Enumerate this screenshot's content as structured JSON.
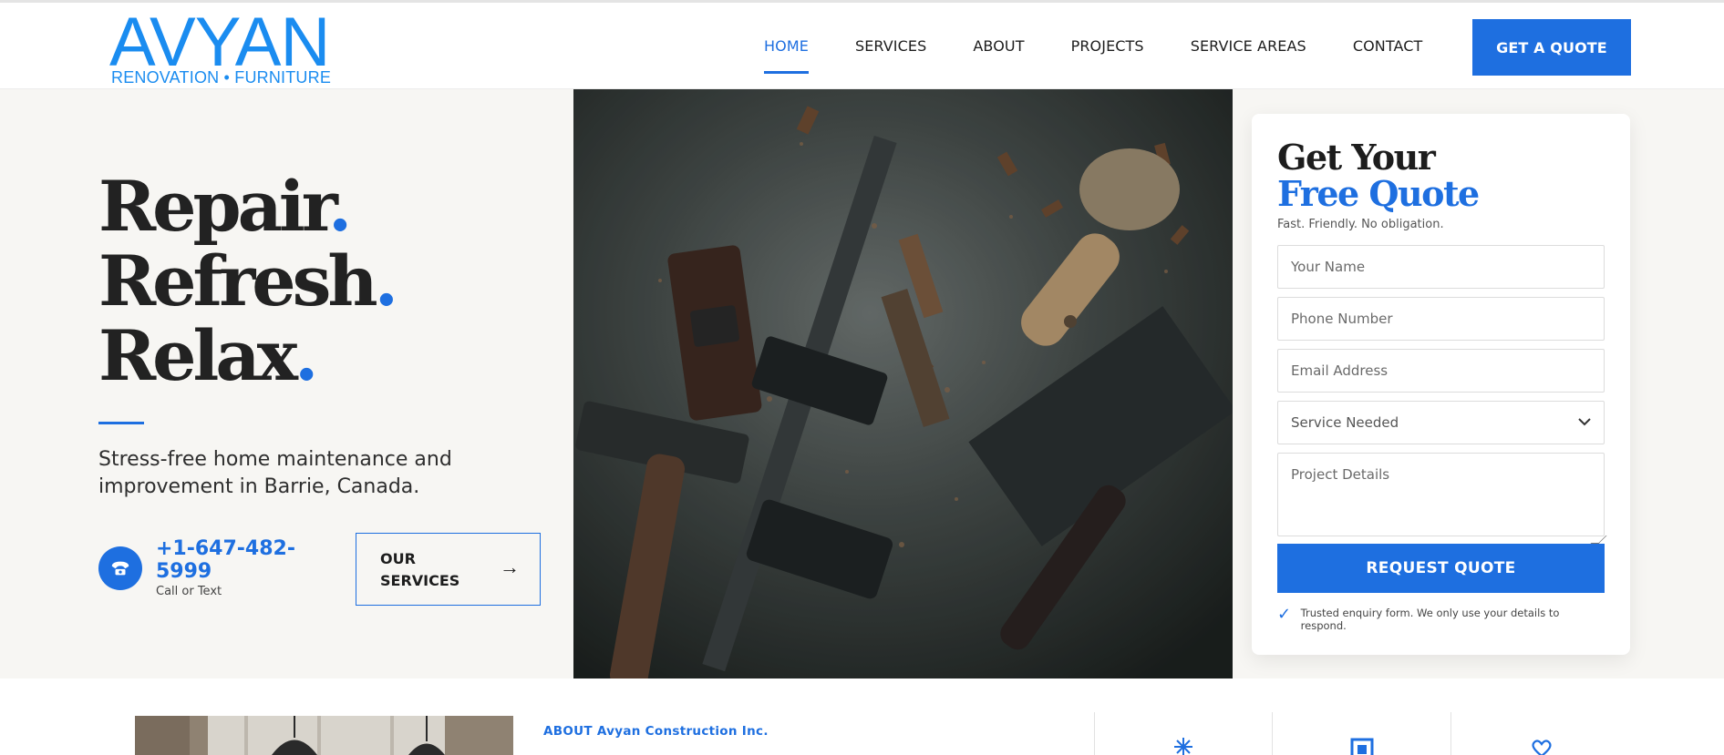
{
  "brand": {
    "name": "AVYAN",
    "tagline": "RENOVATION • FURNITURE",
    "color": "#1a8cf0"
  },
  "nav": {
    "items": [
      {
        "label": "HOME",
        "active": true
      },
      {
        "label": "SERVICES",
        "active": false
      },
      {
        "label": "ABOUT",
        "active": false
      },
      {
        "label": "PROJECTS",
        "active": false
      },
      {
        "label": "SERVICE AREAS",
        "active": false
      },
      {
        "label": "CONTACT",
        "active": false
      }
    ],
    "cta": "GET A QUOTE"
  },
  "hero": {
    "line1": "Repair",
    "line2": "Refresh",
    "line3": "Relax",
    "dot": ".",
    "subtitle": "Stress-free home maintenance and improvement in Barrie, Canada.",
    "phone": "+1-647-482-5999",
    "phone_caption": "Call or Text",
    "phone_icon": "phone-icon",
    "services_button": "OUR SERVICES",
    "services_arrow": "→"
  },
  "quote_form": {
    "title_line1": "Get Your",
    "title_line2": "Free Quote",
    "subtitle": "Fast. Friendly. No obligation.",
    "name_placeholder": "Your Name",
    "phone_placeholder": "Phone Number",
    "email_placeholder": "Email Address",
    "service_selected": "Service Needed",
    "details_placeholder": "Project Details",
    "submit_label": "REQUEST QUOTE",
    "trust_text": "Trusted enquiry form. We only use your details to respond."
  },
  "about": {
    "label": "ABOUT Avyan Construction Inc."
  },
  "colors": {
    "accent": "#1e6fe0",
    "hero_bg": "#f7f6f3",
    "text": "#222222"
  }
}
